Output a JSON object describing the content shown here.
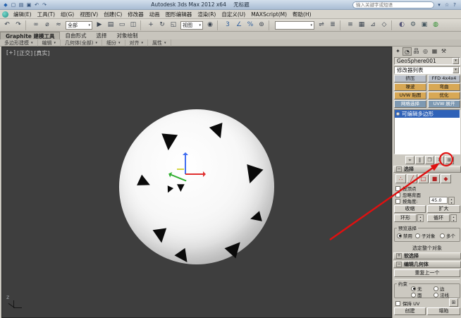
{
  "window": {
    "app_title": "Autodesk 3ds Max 2012 x64",
    "doc_title": "无标题",
    "search_placeholder": "输入关键字或短语",
    "quick_icons": [
      {
        "n": "app-logo-icon",
        "g": "◆",
        "c": "#1f5fae"
      },
      {
        "n": "new-scene-icon",
        "g": "▢"
      },
      {
        "n": "open-file-icon",
        "g": "▤"
      },
      {
        "n": "save-file-icon",
        "g": "▣"
      },
      {
        "n": "undo-quick-icon",
        "g": "↶"
      },
      {
        "n": "redo-quick-icon",
        "g": "↷"
      }
    ],
    "search_icons": [
      {
        "n": "search-scope-icon",
        "g": "▾"
      },
      {
        "n": "favorites-star-icon",
        "g": "☆"
      },
      {
        "n": "help-icon",
        "g": "?"
      }
    ]
  },
  "menubar": {
    "items": [
      "编辑(E)",
      "工具(T)",
      "组(G)",
      "视图(V)",
      "创建(C)",
      "修改器",
      "动画",
      "图形编辑器",
      "渲染(R)",
      "自定义(U)",
      "MAXScript(M)",
      "帮助(H)"
    ]
  },
  "toolbar": {
    "items": [
      {
        "t": "icon",
        "n": "undo-icon",
        "g": "↶"
      },
      {
        "t": "icon",
        "n": "redo-icon",
        "g": "↷"
      },
      {
        "t": "sep"
      },
      {
        "t": "icon",
        "n": "select-and-link-icon",
        "g": "∞"
      },
      {
        "t": "icon",
        "n": "unlink-selection-icon",
        "g": "⌀"
      },
      {
        "t": "icon",
        "n": "bind-to-space-warp-icon",
        "g": "≈"
      },
      {
        "t": "combo",
        "n": "selection-filter-dropdown",
        "v": "全部",
        "w": 38
      },
      {
        "t": "icon",
        "n": "select-object-icon",
        "g": "▶"
      },
      {
        "t": "icon",
        "n": "select-by-name-icon",
        "g": "▤"
      },
      {
        "t": "icon",
        "n": "rectangular-region-icon",
        "g": "▭"
      },
      {
        "t": "icon",
        "n": "window-crossing-icon",
        "g": "◫"
      },
      {
        "t": "sep"
      },
      {
        "t": "icon",
        "n": "select-and-move-icon",
        "g": "+"
      },
      {
        "t": "icon",
        "n": "select-and-rotate-icon",
        "g": "↻"
      },
      {
        "t": "icon",
        "n": "select-and-scale-icon",
        "g": "◱"
      },
      {
        "t": "combo",
        "n": "reference-coordinate-dropdown",
        "v": "视图",
        "w": 32
      },
      {
        "t": "icon",
        "n": "use-pivot-center-icon",
        "g": "◉"
      },
      {
        "t": "sep"
      },
      {
        "t": "icon",
        "n": "snap-toggle-3d-icon",
        "g": "3",
        "c": "#2e5f9e"
      },
      {
        "t": "icon",
        "n": "angle-snap-icon",
        "g": "∠",
        "c": "#2e5f9e"
      },
      {
        "t": "icon",
        "n": "percent-snap-icon",
        "g": "%",
        "c": "#2e5f9e"
      },
      {
        "t": "icon",
        "n": "spinner-snap-icon",
        "g": "⊚"
      },
      {
        "t": "sep"
      },
      {
        "t": "combo",
        "n": "named-selection-sets-dropdown",
        "v": "",
        "w": 56
      },
      {
        "t": "icon",
        "n": "mirror-icon",
        "g": "⇌"
      },
      {
        "t": "icon",
        "n": "align-icon",
        "g": "≣"
      },
      {
        "t": "sep"
      },
      {
        "t": "icon",
        "n": "layer-manager-icon",
        "g": "≡"
      },
      {
        "t": "icon",
        "n": "graphite-ribbon-toggle-icon",
        "g": "▦"
      },
      {
        "t": "icon",
        "n": "curve-editor-icon",
        "g": "⊿"
      },
      {
        "t": "icon",
        "n": "schematic-view-icon",
        "g": "◇"
      },
      {
        "t": "sep"
      },
      {
        "t": "icon",
        "n": "material-editor-icon",
        "g": "◐",
        "c": "#555577"
      },
      {
        "t": "icon",
        "n": "render-setup-icon",
        "g": "⚙",
        "c": "#44565f"
      },
      {
        "t": "icon",
        "n": "rendered-frame-icon",
        "g": "▣",
        "c": "#44565f"
      },
      {
        "t": "icon",
        "n": "render-production-icon",
        "g": "◍",
        "c": "#2f8f2f"
      }
    ]
  },
  "ribbon": {
    "tabs": [
      {
        "label": "Graphite 建模工具",
        "active": true
      },
      {
        "label": "自由形式",
        "active": false
      },
      {
        "label": "选择",
        "active": false
      },
      {
        "label": "对象绘制",
        "active": false
      }
    ],
    "panels": [
      "多边形建模",
      "编辑",
      "几何体(全部)",
      "细分",
      "对齐",
      "属性"
    ]
  },
  "viewport": {
    "labels": [
      "[+]",
      "[正交]",
      "[真实]"
    ],
    "axis_label": "z",
    "triangles": [
      [
        225,
        121,
        30,
        185
      ],
      [
        297,
        108,
        26,
        160
      ],
      [
        194,
        181,
        22,
        115
      ],
      [
        248,
        193,
        14,
        180
      ],
      [
        232,
        197,
        12,
        205
      ],
      [
        342,
        168,
        32,
        198
      ],
      [
        215,
        256,
        26,
        172
      ],
      [
        249,
        287,
        24,
        145
      ],
      [
        321,
        269,
        28,
        42
      ],
      [
        350,
        232,
        20,
        255
      ]
    ]
  },
  "command_panel": {
    "tabs": [
      {
        "n": "create-tab",
        "g": "✦",
        "active": false
      },
      {
        "n": "modify-tab",
        "g": "◔",
        "active": true
      },
      {
        "n": "hierarchy-tab",
        "g": "品",
        "active": false
      },
      {
        "n": "motion-tab",
        "g": "◎",
        "active": false
      },
      {
        "n": "display-tab",
        "g": "▦",
        "active": false
      },
      {
        "n": "utilities-tab",
        "g": "⚒",
        "active": false
      }
    ],
    "object_name": "GeoSphere001",
    "modifier_list_label": "修改器列表",
    "modifier_buttons": [
      {
        "label": "挤压",
        "tone": "gray"
      },
      {
        "label": "FFD 4x4x4",
        "tone": "gray"
      },
      {
        "label": "噪波",
        "tone": "tan"
      },
      {
        "label": "弯曲",
        "tone": "tan"
      },
      {
        "label": "UVW 贴图",
        "tone": "tan"
      },
      {
        "label": "优化",
        "tone": "tan"
      },
      {
        "label": "网格选择",
        "tone": "blue"
      },
      {
        "label": "UVW 展开",
        "tone": "blue"
      }
    ],
    "stack_items": [
      {
        "label": "可编辑多边形",
        "selected": true
      }
    ],
    "stack_toolbar": [
      {
        "n": "pin-stack-button",
        "g": "⌖"
      },
      {
        "n": "show-end-result-button",
        "g": "∥"
      },
      {
        "n": "make-unique-button",
        "g": "❐"
      },
      {
        "n": "remove-modifier-button",
        "g": "✕"
      },
      {
        "n": "configure-modifier-sets-button",
        "g": "⊞"
      }
    ],
    "selection": {
      "sign": "−",
      "title": "选择",
      "mode_buttons": [
        {
          "n": "vertex-mode-button",
          "g": "∴"
        },
        {
          "n": "edge-mode-button",
          "g": "╱"
        },
        {
          "n": "border-mode-button",
          "g": "□"
        },
        {
          "n": "polygon-mode-button",
          "g": "■"
        },
        {
          "n": "element-mode-button",
          "g": "◆"
        }
      ],
      "checkboxes": [
        {
          "label": "按顶点",
          "checked": false
        },
        {
          "label": "忽略背面",
          "checked": false
        },
        {
          "label": "按角度:",
          "checked": false,
          "value": "45.0"
        }
      ],
      "shrink": "收缩",
      "grow": "扩大",
      "ring": "环形",
      "loop": "循环",
      "preview_label": "预览选择",
      "preview_options": [
        {
          "label": "禁用",
          "on": true
        },
        {
          "label": "子对象",
          "on": false
        },
        {
          "label": "多个",
          "on": false
        }
      ],
      "status": "选定整个对象"
    },
    "soft_selection": {
      "sign": "+",
      "title": "软选择"
    },
    "edit_geometry": {
      "sign": "−",
      "title": "编辑几何体",
      "repeat_last": "重复上一个",
      "constraints_label": "约束",
      "constraints": [
        {
          "label": "无",
          "on": true
        },
        {
          "label": "边",
          "on": false
        },
        {
          "label": "面",
          "on": false
        },
        {
          "label": "法线",
          "on": false
        }
      ],
      "preserve_uv": "保持 UV",
      "settings_glyph": "⊞",
      "create": "创建",
      "collapse": "塌陷"
    }
  },
  "annotation": {
    "color": "#e01010"
  }
}
